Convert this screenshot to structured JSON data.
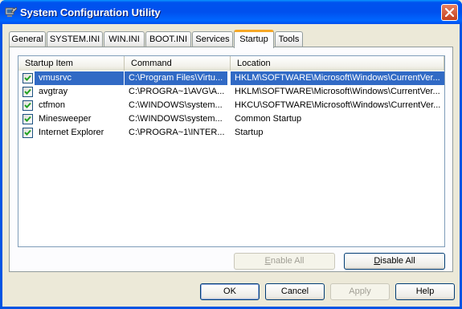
{
  "window": {
    "title": "System Configuration Utility"
  },
  "tabs": [
    {
      "label": "General"
    },
    {
      "label": "SYSTEM.INI"
    },
    {
      "label": "WIN.INI"
    },
    {
      "label": "BOOT.INI"
    },
    {
      "label": "Services"
    },
    {
      "label": "Startup",
      "active": true
    },
    {
      "label": "Tools"
    }
  ],
  "startup_list": {
    "columns": [
      "Startup Item",
      "Command",
      "Location"
    ],
    "rows": [
      {
        "checked": true,
        "item": "vmusrvc",
        "command": "C:\\Program Files\\Virtu...",
        "location": "HKLM\\SOFTWARE\\Microsoft\\Windows\\CurrentVer...",
        "selected": true
      },
      {
        "checked": true,
        "item": "avgtray",
        "command": "C:\\PROGRA~1\\AVG\\A...",
        "location": "HKLM\\SOFTWARE\\Microsoft\\Windows\\CurrentVer..."
      },
      {
        "checked": true,
        "item": "ctfmon",
        "command": "C:\\WINDOWS\\system...",
        "location": "HKCU\\SOFTWARE\\Microsoft\\Windows\\CurrentVer..."
      },
      {
        "checked": true,
        "item": "Minesweeper",
        "command": "C:\\WINDOWS\\system...",
        "location": "Common Startup"
      },
      {
        "checked": true,
        "item": "Internet Explorer",
        "command": "C:\\PROGRA~1\\INTER...",
        "location": "Startup"
      }
    ]
  },
  "panel_buttons": {
    "enable_all_prefix": "",
    "enable_all_mnemonic": "E",
    "enable_all_rest": "nable All",
    "disable_all_prefix": "",
    "disable_all_mnemonic": "D",
    "disable_all_rest": "isable All"
  },
  "dialog_buttons": {
    "ok": "OK",
    "cancel": "Cancel",
    "apply": "Apply",
    "help": "Help"
  },
  "colors": {
    "titlebar": "#0054e3",
    "selection": "#316ac5",
    "tab_highlight": "#f6a826"
  }
}
